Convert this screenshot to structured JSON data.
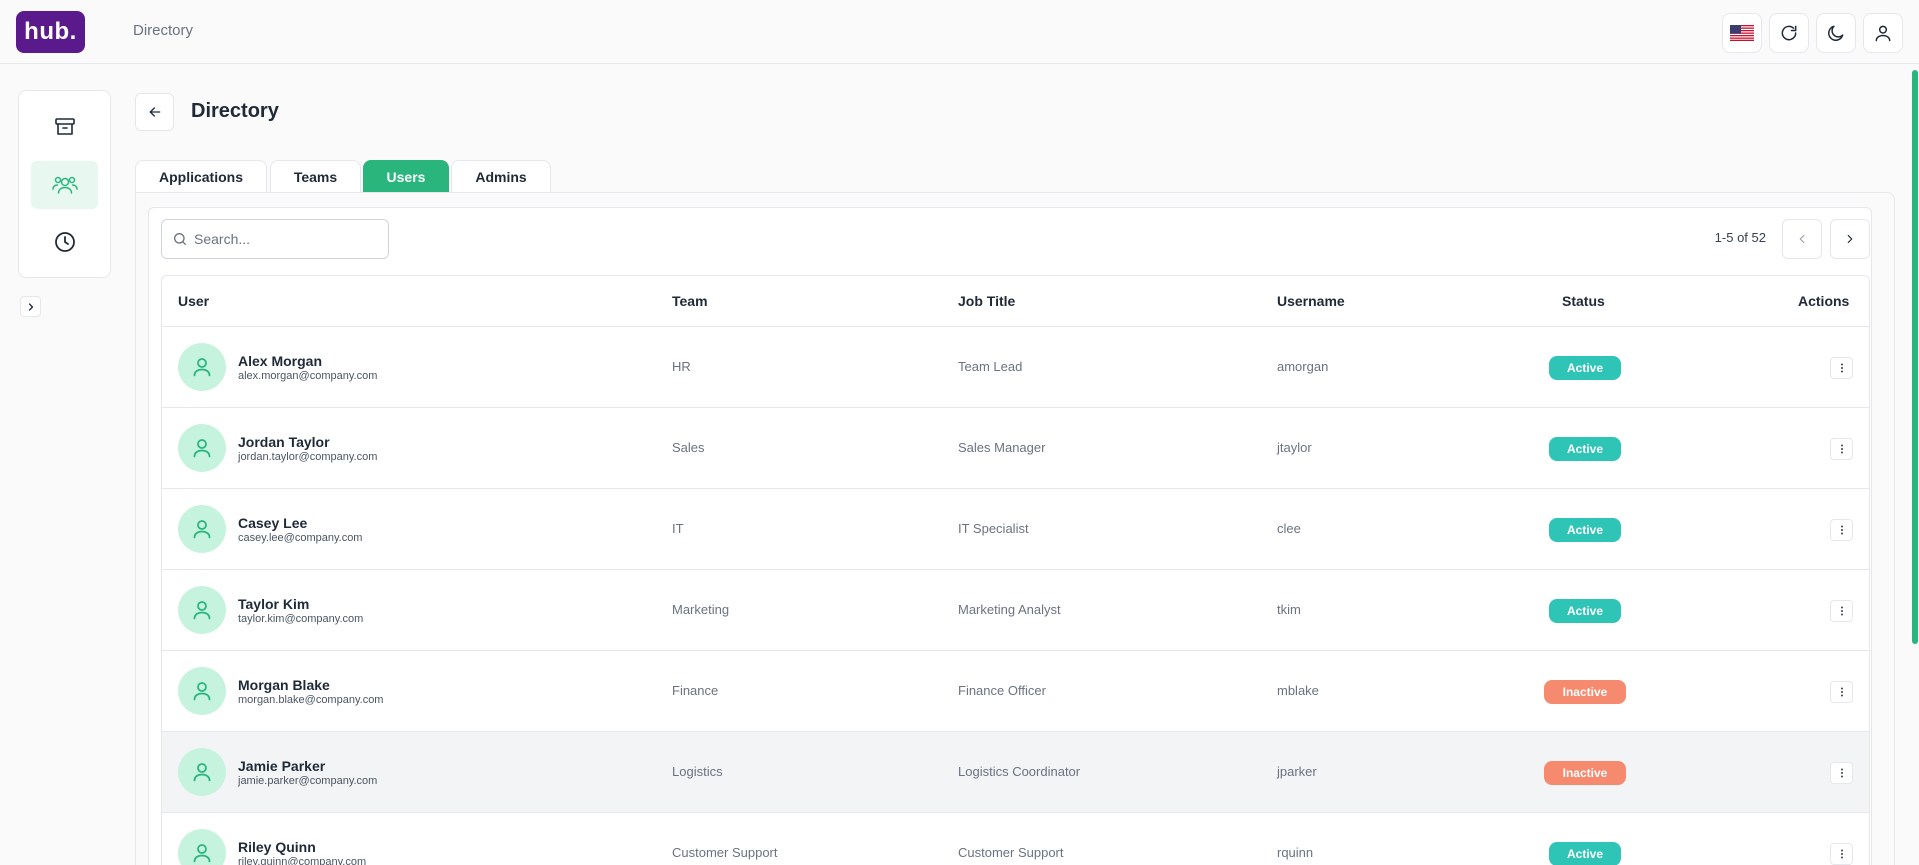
{
  "header": {
    "logo_text": "hub.",
    "breadcrumb": "Directory",
    "icons": [
      "us-flag-icon",
      "refresh-icon",
      "moon-icon",
      "user-icon"
    ]
  },
  "sidebar": {
    "items": [
      {
        "icon": "archive-icon",
        "active": false
      },
      {
        "icon": "users-icon",
        "active": true
      },
      {
        "icon": "clock-icon",
        "active": false
      }
    ]
  },
  "page": {
    "title": "Directory"
  },
  "tabs": [
    {
      "label": "Applications",
      "active": false
    },
    {
      "label": "Teams",
      "active": false
    },
    {
      "label": "Users",
      "active": true
    },
    {
      "label": "Admins",
      "active": false
    }
  ],
  "search": {
    "placeholder": "Search...",
    "value": ""
  },
  "pagination": {
    "label": "1-5 of 52"
  },
  "table": {
    "columns": [
      "User",
      "Team",
      "Job Title",
      "Username",
      "Status",
      "Actions"
    ],
    "rows": [
      {
        "name": "Alex Morgan",
        "email": "alex.morgan@company.com",
        "team": "HR",
        "job": "Team Lead",
        "username": "amorgan",
        "status": "Active"
      },
      {
        "name": "Jordan Taylor",
        "email": "jordan.taylor@company.com",
        "team": "Sales",
        "job": "Sales Manager",
        "username": "jtaylor",
        "status": "Active"
      },
      {
        "name": "Casey Lee",
        "email": "casey.lee@company.com",
        "team": "IT",
        "job": "IT Specialist",
        "username": "clee",
        "status": "Active"
      },
      {
        "name": "Taylor Kim",
        "email": "taylor.kim@company.com",
        "team": "Marketing",
        "job": "Marketing Analyst",
        "username": "tkim",
        "status": "Active"
      },
      {
        "name": "Morgan Blake",
        "email": "morgan.blake@company.com",
        "team": "Finance",
        "job": "Finance Officer",
        "username": "mblake",
        "status": "Inactive"
      },
      {
        "name": "Jamie Parker",
        "email": "jamie.parker@company.com",
        "team": "Logistics",
        "job": "Logistics Coordinator",
        "username": "jparker",
        "status": "Inactive"
      },
      {
        "name": "Riley Quinn",
        "email": "riley.quinn@company.com",
        "team": "Customer Support",
        "job": "Customer Support",
        "username": "rquinn",
        "status": "Active"
      }
    ]
  },
  "colors": {
    "brand": "#5b1a8c",
    "accent": "#2ab57d",
    "status_active": "#2ec4b6",
    "status_inactive": "#f58a6e"
  }
}
